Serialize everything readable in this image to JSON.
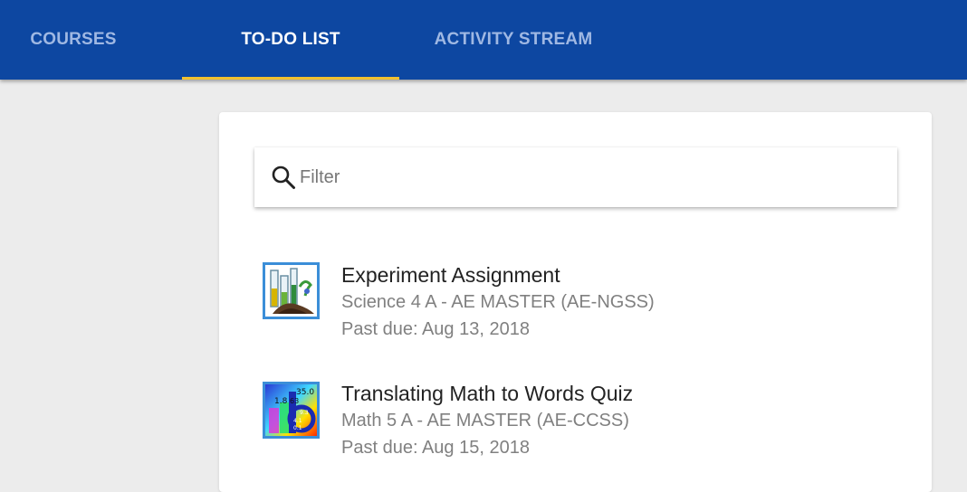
{
  "tabs": [
    {
      "label": "COURSES",
      "active": false
    },
    {
      "label": "TO-DO LIST",
      "active": true
    },
    {
      "label": "ACTIVITY STREAM",
      "active": false
    }
  ],
  "filter": {
    "placeholder": "Filter",
    "value": "",
    "icon": "search-icon"
  },
  "todo_items": [
    {
      "title": "Experiment Assignment",
      "course": "Science 4 A - AE MASTER (AE-NGSS)",
      "due": "Past due: Aug 13, 2018",
      "icon": "science-lab-icon"
    },
    {
      "title": "Translating Math to Words Quiz",
      "course": "Math 5 A - AE MASTER (AE-CCSS)",
      "due": "Past due: Aug 15, 2018",
      "icon": "math-chart-icon",
      "icon_labels": [
        "35.0",
        "1.8",
        "63",
        "9.3",
        "4.1",
        "0.1"
      ]
    }
  ],
  "colors": {
    "header_bg": "#0d47a1",
    "tab_active": "#ffffff",
    "tab_inactive": "#9fb8e3",
    "tab_indicator": "#f2c12e",
    "page_bg": "#ececec",
    "thumb_border": "#3b8ed8"
  }
}
